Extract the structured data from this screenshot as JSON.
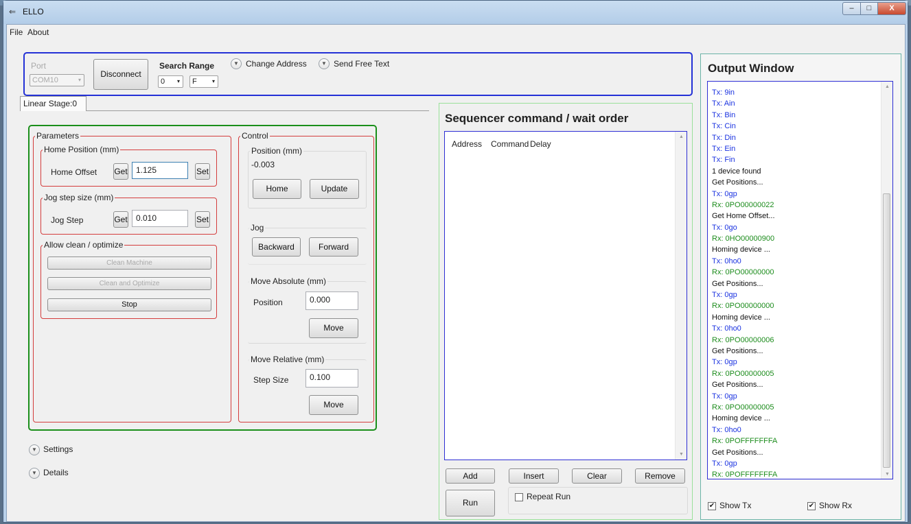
{
  "window": {
    "title": "ELLO",
    "min_label": "–",
    "max_label": "□",
    "close_label": "X"
  },
  "menu": {
    "file": "File",
    "about": "About"
  },
  "connection": {
    "port_label": "Port",
    "port_value": "COM10",
    "disconnect_label": "Disconnect",
    "search_range_label": "Search Range",
    "range_from": "0",
    "range_to": "F",
    "change_address_label": "Change Address",
    "send_free_text_label": "Send Free Text"
  },
  "tab": {
    "label": "Linear Stage:0"
  },
  "parameters": {
    "caption": "Parameters",
    "home_position": {
      "caption": "Home Position (mm)",
      "label": "Home Offset",
      "get_label": "Get",
      "value": "1.125",
      "set_label": "Set"
    },
    "jog_step_size": {
      "caption": "Jog step size (mm)",
      "label": "Jog Step",
      "get_label": "Get",
      "value": "0.010",
      "set_label": "Set"
    },
    "allow_clean": {
      "caption": "Allow clean / optimize",
      "clean_machine": "Clean Machine",
      "clean_optimize": "Clean and Optimize",
      "stop": "Stop"
    }
  },
  "control": {
    "caption": "Control",
    "position": {
      "caption": "Position (mm)",
      "value": "-0.003",
      "home_label": "Home",
      "update_label": "Update"
    },
    "jog": {
      "caption": "Jog",
      "backward_label": "Backward",
      "forward_label": "Forward"
    },
    "move_absolute": {
      "caption": "Move Absolute (mm)",
      "label": "Position",
      "value": "0.000",
      "move_label": "Move"
    },
    "move_relative": {
      "caption": "Move Relative (mm)",
      "label": "Step Size",
      "value": "0.100",
      "move_label": "Move"
    }
  },
  "expanders": {
    "settings": "Settings",
    "details": "Details"
  },
  "sequencer": {
    "title": "Sequencer command / wait order",
    "columns": [
      "Address",
      "Command",
      "Delay"
    ],
    "add_label": "Add",
    "insert_label": "Insert",
    "clear_label": "Clear",
    "remove_label": "Remove",
    "run_label": "Run",
    "repeat_run_label": "Repeat Run"
  },
  "output": {
    "title": "Output Window",
    "lines": [
      {
        "kind": "tx",
        "text": "Tx: 9in"
      },
      {
        "kind": "tx",
        "text": "Tx: Ain"
      },
      {
        "kind": "tx",
        "text": "Tx: Bin"
      },
      {
        "kind": "tx",
        "text": "Tx: Cin"
      },
      {
        "kind": "tx",
        "text": "Tx: Din"
      },
      {
        "kind": "tx",
        "text": "Tx: Ein"
      },
      {
        "kind": "tx",
        "text": "Tx: Fin"
      },
      {
        "kind": "st",
        "text": "1 device found"
      },
      {
        "kind": "st",
        "text": "Get Positions..."
      },
      {
        "kind": "tx",
        "text": "Tx: 0gp"
      },
      {
        "kind": "rx",
        "text": "Rx: 0PO00000022"
      },
      {
        "kind": "st",
        "text": "Get Home Offset..."
      },
      {
        "kind": "tx",
        "text": "Tx: 0go"
      },
      {
        "kind": "rx",
        "text": "Rx: 0HO00000900"
      },
      {
        "kind": "st",
        "text": "Homing device ..."
      },
      {
        "kind": "tx",
        "text": "Tx: 0ho0"
      },
      {
        "kind": "rx",
        "text": "Rx: 0PO00000000"
      },
      {
        "kind": "st",
        "text": "Get Positions..."
      },
      {
        "kind": "tx",
        "text": "Tx: 0gp"
      },
      {
        "kind": "rx",
        "text": "Rx: 0PO00000000"
      },
      {
        "kind": "st",
        "text": "Homing device ..."
      },
      {
        "kind": "tx",
        "text": "Tx: 0ho0"
      },
      {
        "kind": "rx",
        "text": "Rx: 0PO00000006"
      },
      {
        "kind": "st",
        "text": "Get Positions..."
      },
      {
        "kind": "tx",
        "text": "Tx: 0gp"
      },
      {
        "kind": "rx",
        "text": "Rx: 0PO00000005"
      },
      {
        "kind": "st",
        "text": "Get Positions..."
      },
      {
        "kind": "tx",
        "text": "Tx: 0gp"
      },
      {
        "kind": "rx",
        "text": "Rx: 0PO00000005"
      },
      {
        "kind": "st",
        "text": "Homing device ..."
      },
      {
        "kind": "tx",
        "text": "Tx: 0ho0"
      },
      {
        "kind": "rx",
        "text": "Rx: 0POFFFFFFFA"
      },
      {
        "kind": "st",
        "text": "Get Positions..."
      },
      {
        "kind": "tx",
        "text": "Tx: 0gp"
      },
      {
        "kind": "rx",
        "text": "Rx: 0POFFFFFFFA"
      }
    ],
    "show_tx_label": "Show Tx",
    "show_rx_label": "Show Rx",
    "show_tx_checked": true,
    "show_rx_checked": true
  },
  "icons": {
    "chevron": "chevron-down-icon",
    "checkmark": "✔"
  },
  "colors": {
    "tx": "#1a32e0",
    "rx": "#1c8c1c",
    "connection_border": "#2330d6",
    "stage_border": "#1a8f1a",
    "group_border": "#d43c3c"
  }
}
